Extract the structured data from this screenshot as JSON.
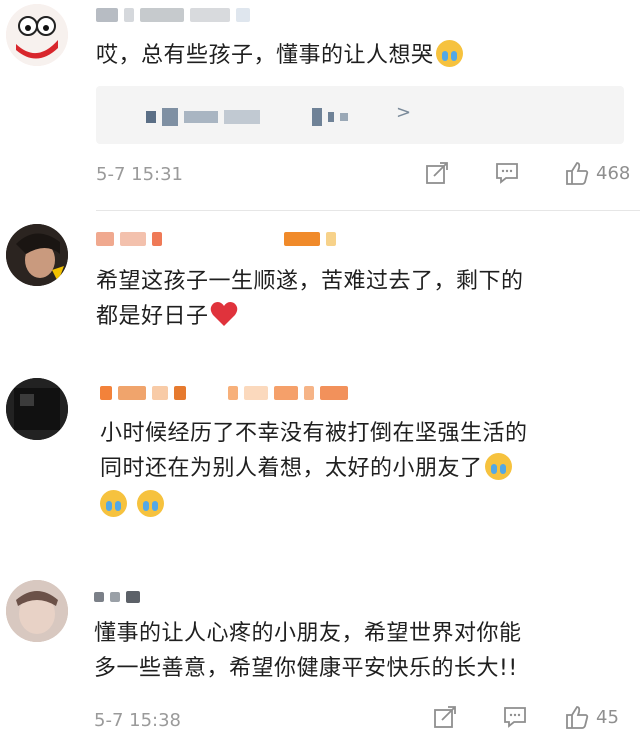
{
  "comments": [
    {
      "text_lines": [
        "哎，总有些孩子，懂事的让人想哭"
      ],
      "quote_arrow": ">",
      "time": "5-7 15:31",
      "likes": "468"
    },
    {
      "text_lines": [
        "希望这孩子一生顺遂，苦难过去了，剩下的",
        "都是好日子"
      ]
    },
    {
      "text_lines": [
        "小时候经历了不幸没有被打倒在坚强生活的",
        "同时还在为别人着想，太好的小朋友了"
      ]
    },
    {
      "text_lines": [
        "懂事的让人心疼的小朋友，希望世界对你能",
        "多一些善意，希望你健康平安快乐的长大!!"
      ],
      "time": "5-7 15:38",
      "likes": "45"
    }
  ],
  "colors": {
    "emoji_face": "#f6c23e",
    "emoji_tears": "#53a8e6",
    "heart": "#e0333c",
    "meta_gray": "#9a9a9a"
  },
  "icons": [
    "share-icon",
    "comment-icon",
    "like-icon",
    "crying-emoji",
    "heart-emoji"
  ]
}
